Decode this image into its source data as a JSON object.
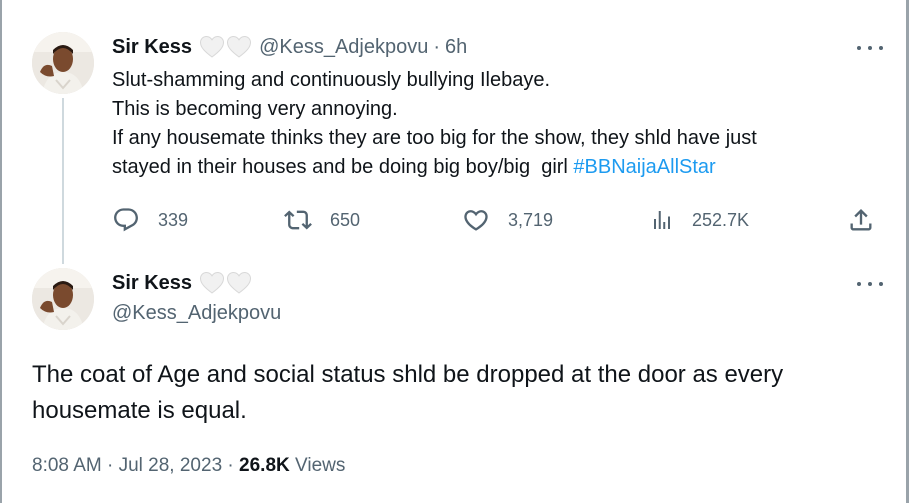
{
  "reply_tweet": {
    "display_name": "Sir Kess",
    "badge_icons": [
      "white-heart-icon",
      "white-heart-icon"
    ],
    "handle": "@Kess_Adjekpovu",
    "separator": "·",
    "time": "6h",
    "text_lines": [
      "Slut-shamming and continuously bullying Ilebaye.",
      "This is becoming very annoying.",
      "If any housemate thinks they are too big for the show, they shld have just",
      "stayed in their houses and be doing big boy/big  girl "
    ],
    "hashtag": "#BBNaijaAllStar",
    "actions": {
      "replies": "339",
      "retweets": "650",
      "likes": "3,719",
      "views": "252.7K"
    }
  },
  "main_tweet": {
    "display_name": "Sir Kess",
    "badge_icons": [
      "white-heart-icon",
      "white-heart-icon"
    ],
    "handle": "@Kess_Adjekpovu",
    "text": "The coat of Age and social status shld be dropped at the door as every housemate is equal.",
    "time": "8:08 AM",
    "separator1": "·",
    "date": "Jul 28, 2023",
    "separator2": "·",
    "views_count": "26.8K",
    "views_label": "Views"
  },
  "colors": {
    "text_primary": "#0f1419",
    "text_secondary": "#536471",
    "link": "#1d9bf0",
    "thread_line": "#cfd9de"
  }
}
